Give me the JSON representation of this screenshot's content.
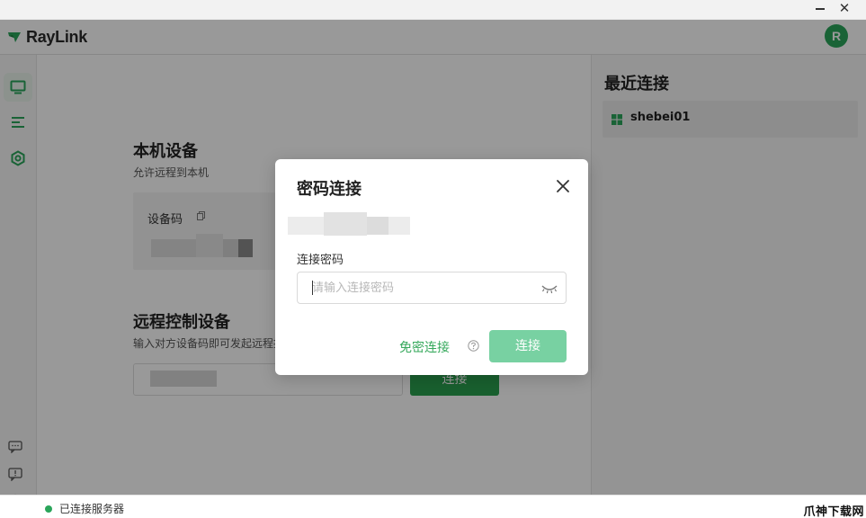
{
  "app": {
    "name": "RayLink"
  },
  "header": {
    "avatar_letter": "R"
  },
  "sidebar": {
    "items": [
      {
        "name": "monitor-icon",
        "active": true
      },
      {
        "name": "list-icon",
        "active": false
      },
      {
        "name": "settings-icon",
        "active": false
      }
    ],
    "bottom": [
      "chat-icon",
      "feedback-icon",
      "compass-icon"
    ]
  },
  "local": {
    "title": "本机设备",
    "subtitle": "允许远程到本机",
    "code_label": "设备码"
  },
  "remote": {
    "title": "远程控制设备",
    "subtitle": "输入对方设备码即可发起远程控",
    "connect_label": "连接"
  },
  "recent": {
    "title": "最近连接",
    "items": [
      {
        "name": "shebei01",
        "os": "windows"
      }
    ]
  },
  "status": {
    "text": "已连接服务器"
  },
  "watermark": "爪神下载网",
  "dialog": {
    "title": "密码连接",
    "password_label": "连接密码",
    "password_placeholder": "请输入连接密码",
    "password_value": "",
    "no_password_label": "免密连接",
    "connect_label": "连接"
  },
  "colors": {
    "brand_green": "#2aa55a",
    "button_green": "#2aa04f",
    "button_disabled": "#78d1a2",
    "link_green": "#35a85b"
  }
}
